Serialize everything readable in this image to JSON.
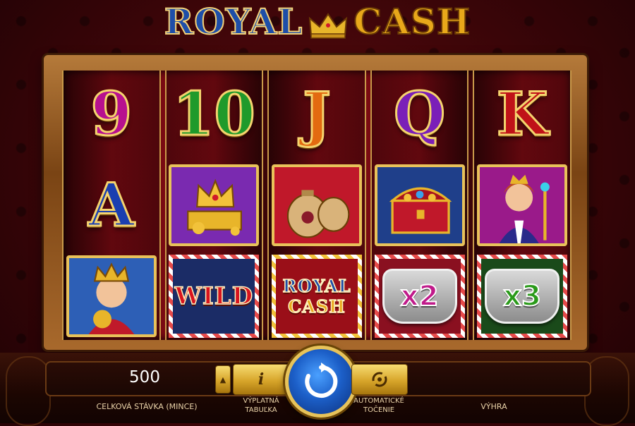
{
  "game": {
    "title_word_1": "ROYAL",
    "title_word_2": "CASH",
    "logo_icon": "crown-icon"
  },
  "reels": [
    [
      {
        "kind": "letter",
        "text": "9",
        "color": "#b7108f"
      },
      {
        "kind": "letter",
        "text": "A",
        "color": "#1a3fb0"
      },
      {
        "kind": "tile",
        "symbol": "king-icon",
        "bg": "#2d5fb6"
      }
    ],
    [
      {
        "kind": "letter",
        "text": "10",
        "color": "#1f9a2b"
      },
      {
        "kind": "tile",
        "symbol": "gold-crown-icon",
        "bg": "#7a2ab0"
      },
      {
        "kind": "wild",
        "text": "WILD",
        "bg": "#1b2c66"
      }
    ],
    [
      {
        "kind": "letter",
        "text": "J",
        "color": "#e36a10"
      },
      {
        "kind": "tile",
        "symbol": "money-bags-icon",
        "bg": "#c0182a"
      },
      {
        "kind": "logo",
        "text1": "ROYAL",
        "text2": "CASH",
        "bg": "#9a0f18"
      }
    ],
    [
      {
        "kind": "letter",
        "text": "Q",
        "color": "#7a1fb8"
      },
      {
        "kind": "tile",
        "symbol": "treasure-chest-icon",
        "bg": "#1f3f8a"
      },
      {
        "kind": "mult",
        "text": "x2",
        "color": "#c01a8a",
        "bg": "#8a1020"
      }
    ],
    [
      {
        "kind": "letter",
        "text": "K",
        "color": "#c01218"
      },
      {
        "kind": "tile",
        "symbol": "queen-icon",
        "bg": "#9a1a8a"
      },
      {
        "kind": "mult",
        "text": "x3",
        "color": "#2a9a1a",
        "bg": "#1a4a1a"
      }
    ]
  ],
  "controls": {
    "bet_value": "500",
    "bet_label": "CELKOVÁ STÁVKA (MINCE)",
    "info_label": "i",
    "paytable_line1": "VÝPLATNÁ",
    "paytable_line2": "TABUĽKA",
    "autoplay_line1": "AUTOMATICKÉ",
    "autoplay_line2": "TOČENIE",
    "win_label": "VÝHRA",
    "win_value": "",
    "spin_icon": "refresh-arrow-icon",
    "autoplay_icon": "autoplay-cycle-icon",
    "bet_arrow_icon": "caret-up-icon"
  },
  "colors": {
    "gold": "#e7c35a",
    "velvet": "#5a0a0e",
    "spin_blue": "#1c5fc8"
  }
}
